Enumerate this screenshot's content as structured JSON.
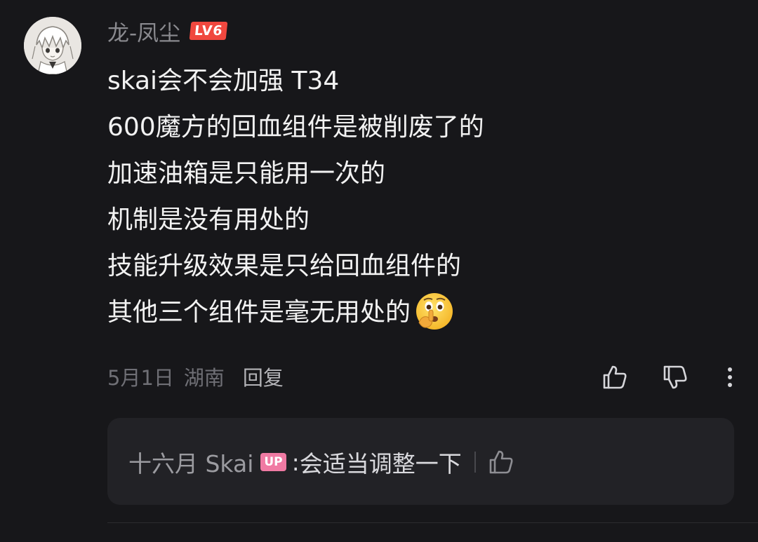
{
  "comment": {
    "username": "龙-凤尘",
    "level_badge": "LV6",
    "body_lines": [
      "skai会不会加强 T34",
      "600魔方的回血组件是被削废了的",
      "加速油箱是只能用一次的",
      "机制是没有用处的",
      "技能升级效果是只给回血组件的",
      "其他三个组件是毫无用处的"
    ],
    "trailing_emoji": "shushing-face-emoji",
    "date": "5月1日",
    "location": "湖南",
    "reply_label": "回复",
    "actions": [
      "thumbs-up-icon",
      "thumbs-down-icon",
      "more-vertical-icon"
    ]
  },
  "reply": {
    "user": "十六月 Skai",
    "badge": "UP",
    "separator": ":",
    "text": "会适当调整一下",
    "like_icon": "thumbs-up-icon"
  },
  "colors": {
    "background": "#17171a",
    "reply_box": "#222226",
    "level_badge": "#f0483f",
    "up_badge": "#f07aa3"
  }
}
